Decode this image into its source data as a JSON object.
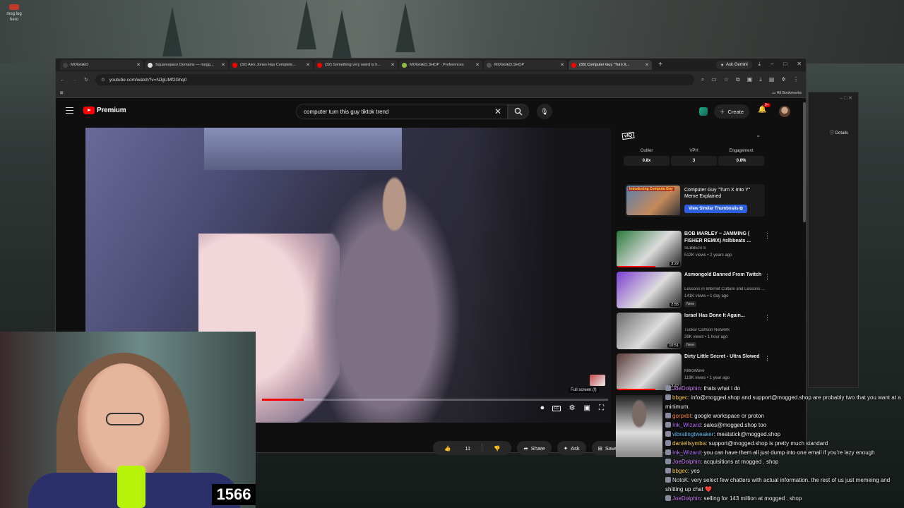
{
  "desktop": {
    "icon_label": "mog log hero"
  },
  "browser": {
    "tabs": [
      {
        "label": "MOGGED",
        "color": "#444444"
      },
      {
        "label": "Squarespace Domains — mogg...",
        "color": "#dddddd"
      },
      {
        "label": "(32) Alex Jones Has Complete...",
        "color": "#ff0000"
      },
      {
        "label": "(32) Something very weird is h...",
        "color": "#ff0000"
      },
      {
        "label": "MOGGED.SHOP - Preferences",
        "color": "#95bf47"
      },
      {
        "label": "MOGGED.SHOP",
        "color": "#555555"
      },
      {
        "label": "(33) Computer Guy \"Turn X...",
        "color": "#ff0000"
      }
    ],
    "gemini_label": "Ask Gemini",
    "url": "youtube.com/watch?v=NJgUMf2Ghq0",
    "bookmarks_label": "All Bookmarks"
  },
  "youtube": {
    "logo_text": "Premium",
    "search_query": "computer turn this guy tiktok trend",
    "create_label": "Create",
    "notif_count": "9+",
    "player": {
      "tooltip": "Full screen (f)",
      "progress": 0.12
    },
    "actions": {
      "likes": "11",
      "share": "Share",
      "ask": "Ask",
      "save": "Save"
    }
  },
  "vidiq": {
    "logo": "vIQ",
    "metrics": [
      {
        "label": "Outlier",
        "value": "0.8x"
      },
      {
        "label": "VPH",
        "value": "3"
      },
      {
        "label": "Engagement",
        "value": "0.8%"
      }
    ],
    "card": {
      "thumb_caption": "Introducing Computa Guy",
      "title": "Computer Guy \"Turn X Into Y\" Meme Explained",
      "button": "View Similar Thumbnails"
    }
  },
  "recommendations": [
    {
      "title": "BOB MARLEY ~ JAMMING ( FISHER REMIX) #slbbeats ...",
      "channel": "SLBBEATS",
      "meta": "513K views • 2 years ago",
      "duration": "3:22",
      "new": false,
      "thumb": "#2a7a3a"
    },
    {
      "title": "Asmongold Banned From Twitch",
      "channel": "Lessons in Internet Culture and Lessons ...",
      "meta": "141K views • 1 day ago",
      "duration": "2:55",
      "new": true,
      "thumb": "#7b3fd0"
    },
    {
      "title": "Israel Has Done It Again...",
      "channel": "Tucker Carlson Network",
      "meta": "39K views • 1 hour ago",
      "duration": "10:51",
      "new": true,
      "thumb": "#6b6b6b"
    },
    {
      "title": "Dirty Little Secret - Ultra Slowed",
      "channel": "MitroWave",
      "meta": "119K views • 1 year ago",
      "duration": "2:42",
      "new": false,
      "thumb": "#5a3a38"
    }
  ],
  "ghost_window": {
    "details": "Details"
  },
  "webcam": {
    "counter": "1566"
  },
  "chat": [
    {
      "user": "JoeDolphin",
      "color": "#d67cff",
      "text": "thats what i do"
    },
    {
      "user": "bbgec",
      "color": "#ffd23c",
      "text": "info@mogged.shop and support@mogged.shop are probably two that you want at a minimum."
    },
    {
      "user": "gorpxbt",
      "color": "#ff8a3c",
      "text": "google workspace or proton"
    },
    {
      "user": "Ink_Wizard",
      "color": "#b06bff",
      "text": "sales@mogged.shop too"
    },
    {
      "user": "vibratingtweaker",
      "color": "#66c2ff",
      "text": "meatstick@mogged.shop"
    },
    {
      "user": "danieltsymba",
      "color": "#ffd23c",
      "text": "support@mogged.shop is pretty much standard"
    },
    {
      "user": "Ink_Wizard",
      "color": "#b06bff",
      "text": "you can have them all just dump into one email if you're lazy enough"
    },
    {
      "user": "JoeDolphin",
      "color": "#d67cff",
      "text": "acquisitions at mogged . shop"
    },
    {
      "user": "bbgec",
      "color": "#ffd23c",
      "text": "yes"
    },
    {
      "user": "NotoK",
      "color": "#e8e8e8",
      "text": "very select few chatters with actual information. the rest of us just memeing and shitting up chat ❤️"
    },
    {
      "user": "JoeDolphin",
      "color": "#d67cff",
      "text": "selling for 143 million at mogged . shop"
    }
  ]
}
